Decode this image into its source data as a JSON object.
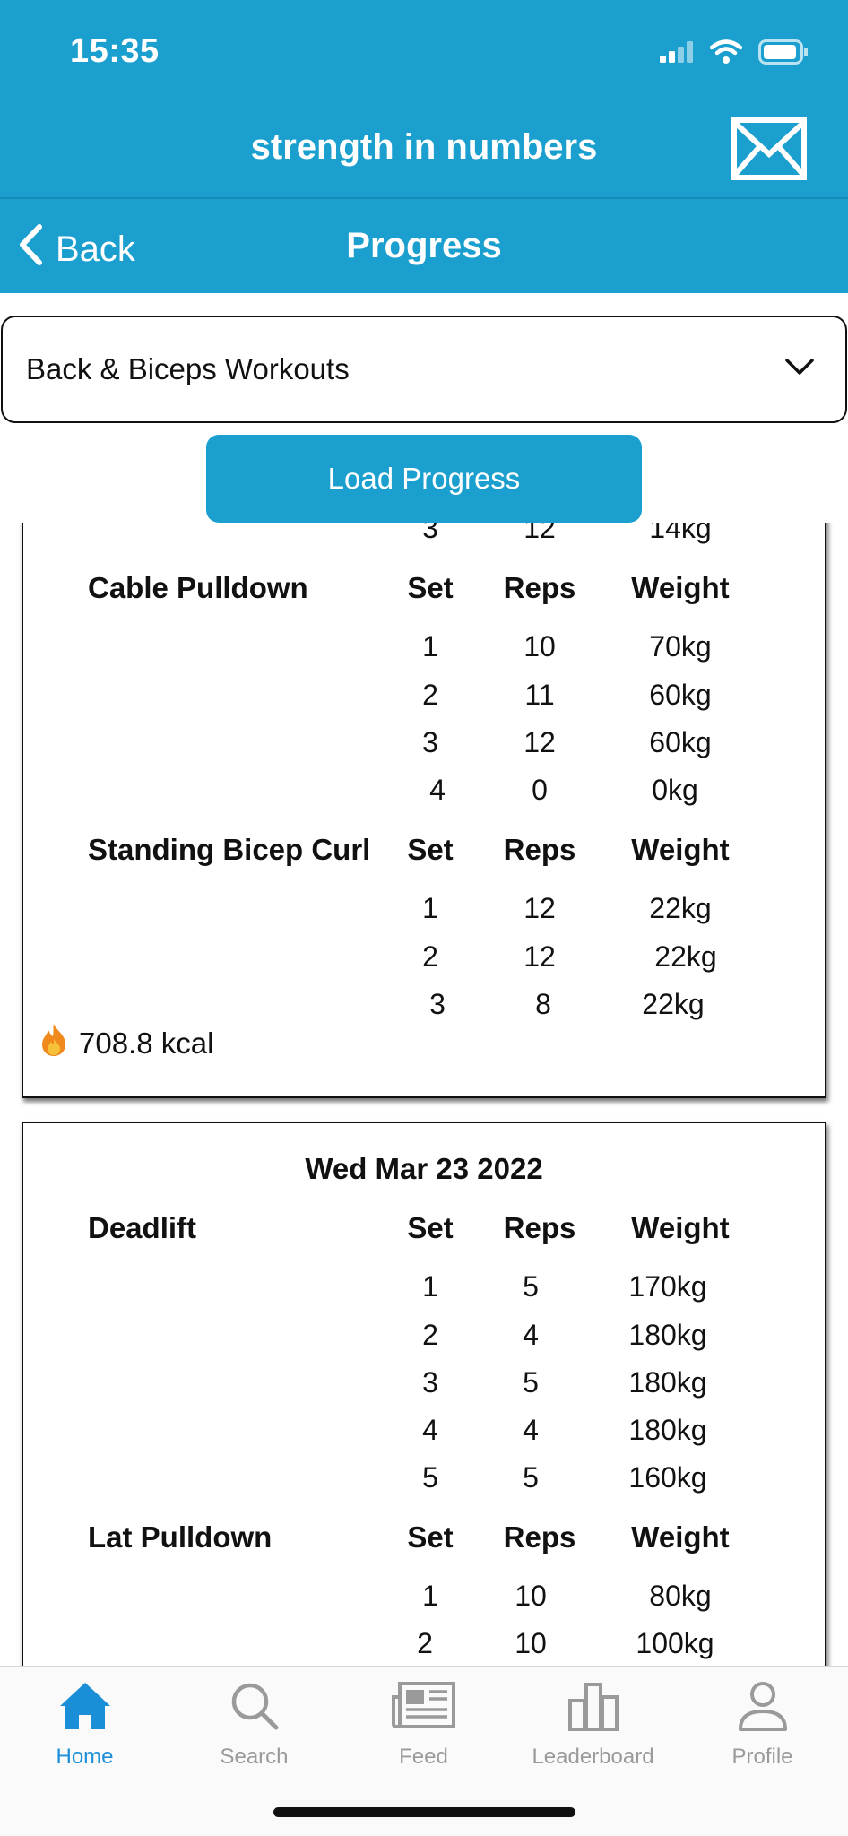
{
  "status_bar": {
    "time": "15:35"
  },
  "app": {
    "title": "strength in numbers"
  },
  "nav": {
    "back_label": "Back",
    "title": "Progress"
  },
  "workout_select": {
    "selected": "Back & Biceps Workouts"
  },
  "load_button": {
    "label": "Load Progress"
  },
  "sessions": [
    {
      "date": "",
      "exercises": [
        {
          "name": "",
          "headers": {
            "set": "",
            "reps": "",
            "weight": ""
          },
          "rows": [
            {
              "set": "3",
              "reps": "12",
              "weight": "14kg"
            }
          ]
        },
        {
          "name": "Cable Pulldown",
          "headers": {
            "set": "Set",
            "reps": "Reps",
            "weight": "Weight"
          },
          "rows": [
            {
              "set": "1",
              "reps": "10",
              "weight": "70kg"
            },
            {
              "set": "2",
              "reps": "11",
              "weight": "60kg"
            },
            {
              "set": "3",
              "reps": "12",
              "weight": "60kg"
            },
            {
              "set": "4",
              "reps": "0",
              "weight": "0kg"
            }
          ]
        },
        {
          "name": "Standing Bicep Curl",
          "headers": {
            "set": "Set",
            "reps": "Reps",
            "weight": "Weight"
          },
          "rows": [
            {
              "set": "1",
              "reps": "12",
              "weight": "22kg"
            },
            {
              "set": "2",
              "reps": "12",
              "weight": "22kg"
            },
            {
              "set": "3",
              "reps": "8",
              "weight": "22kg"
            }
          ]
        }
      ],
      "kcal": "708.8 kcal"
    },
    {
      "date": "Wed Mar 23 2022",
      "exercises": [
        {
          "name": "Deadlift",
          "headers": {
            "set": "Set",
            "reps": "Reps",
            "weight": "Weight"
          },
          "rows": [
            {
              "set": "1",
              "reps": "5",
              "weight": "170kg"
            },
            {
              "set": "2",
              "reps": "4",
              "weight": "180kg"
            },
            {
              "set": "3",
              "reps": "5",
              "weight": "180kg"
            },
            {
              "set": "4",
              "reps": "4",
              "weight": "180kg"
            },
            {
              "set": "5",
              "reps": "5",
              "weight": "160kg"
            }
          ]
        },
        {
          "name": "Lat Pulldown",
          "headers": {
            "set": "Set",
            "reps": "Reps",
            "weight": "Weight"
          },
          "rows": [
            {
              "set": "1",
              "reps": "10",
              "weight": "80kg"
            },
            {
              "set": "2",
              "reps": "10",
              "weight": "100kg"
            }
          ]
        }
      ]
    }
  ],
  "tabs": [
    {
      "label": "Home",
      "icon": "home-icon",
      "active": true
    },
    {
      "label": "Search",
      "icon": "search-icon",
      "active": false
    },
    {
      "label": "Feed",
      "icon": "newspaper-icon",
      "active": false
    },
    {
      "label": "Leaderboard",
      "icon": "bar-chart-icon",
      "active": false
    },
    {
      "label": "Profile",
      "icon": "person-icon",
      "active": false
    }
  ],
  "colors": {
    "brand": "#1a9fcf",
    "tab_active": "#1a8fd8",
    "tab_inactive": "#9a9a9a"
  }
}
